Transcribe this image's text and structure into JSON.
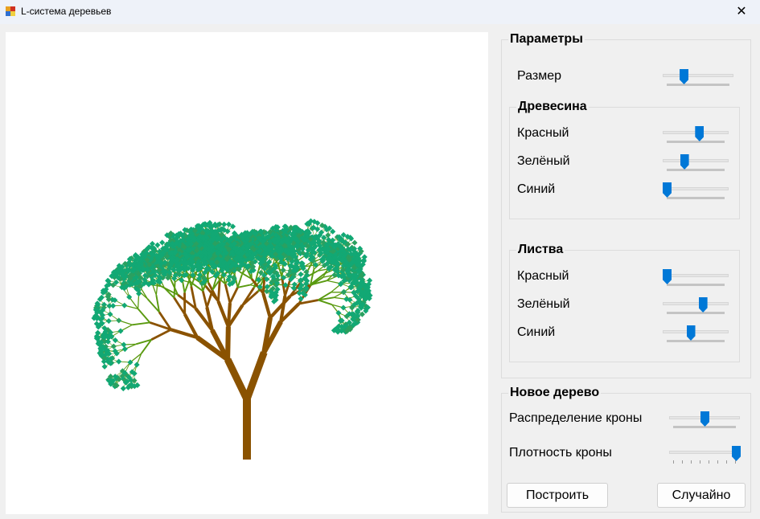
{
  "window": {
    "title": "L-система деревьев",
    "close_icon": "close-icon"
  },
  "colors": {
    "wood": "#8a5200",
    "leaf": "#12a874",
    "leaf_alt": "#5a9a10",
    "accent": "#0078d7"
  },
  "params": {
    "legend": "Параметры",
    "size": {
      "label": "Размер",
      "value": 0.27
    },
    "wood": {
      "legend": "Древесина",
      "red": {
        "label": "Красный",
        "value": 0.56
      },
      "green": {
        "label": "Зелёный",
        "value": 0.3
      },
      "blue": {
        "label": "Синий",
        "value": 0.0
      }
    },
    "leaves": {
      "legend": "Листва",
      "red": {
        "label": "Красный",
        "value": 0.0
      },
      "green": {
        "label": "Зелёный",
        "value": 0.62
      },
      "blue": {
        "label": "Синий",
        "value": 0.41
      }
    }
  },
  "new_tree": {
    "legend": "Новое дерево",
    "distribution": {
      "label": "Распределение кроны",
      "value": 0.5
    },
    "density": {
      "label": "Плотность кроны",
      "value": 1.0
    },
    "build_label": "Построить",
    "random_label": "Случайно"
  }
}
